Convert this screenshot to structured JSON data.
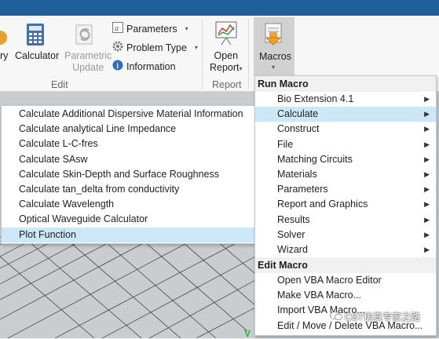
{
  "ribbon": {
    "partial_left_label": "ry",
    "calculator_label": "Calculator",
    "parametric_update_line1": "Parametric",
    "parametric_update_line2": "Update",
    "parameters_label": "Parameters",
    "problem_type_label": "Problem Type",
    "information_label": "Information",
    "edit_group_label": "Edit",
    "open_report_line1": "Open",
    "open_report_line2": "Report",
    "report_group_label": "Report",
    "macros_label": "Macros"
  },
  "macro_menu": {
    "run_header": "Run Macro",
    "run_items": [
      {
        "label": "Bio Extension 4.1"
      },
      {
        "label": "Calculate"
      },
      {
        "label": "Construct"
      },
      {
        "label": "File"
      },
      {
        "label": "Matching Circuits"
      },
      {
        "label": "Materials"
      },
      {
        "label": "Parameters"
      },
      {
        "label": "Report and Graphics"
      },
      {
        "label": "Results"
      },
      {
        "label": "Solver"
      },
      {
        "label": "Wizard"
      }
    ],
    "edit_header": "Edit Macro",
    "edit_items": [
      {
        "label": "Open VBA Macro Editor"
      },
      {
        "label": "Make VBA Macro..."
      },
      {
        "label": "Import VBA Macro..."
      },
      {
        "label": "Edit / Move / Delete VBA Macro..."
      }
    ]
  },
  "calculate_submenu": {
    "items": [
      {
        "label": "Calculate Additional Dispersive Material Information"
      },
      {
        "label": "Calculate analytical Line Impedance"
      },
      {
        "label": "Calculate L-C-fres"
      },
      {
        "label": "Calculate SAsw"
      },
      {
        "label": "Calculate Skin-Depth and Surface Roughness"
      },
      {
        "label": "Calculate tan_delta from conductivity"
      },
      {
        "label": "Calculate Wavelength"
      },
      {
        "label": "Optical Waveguide Calculator"
      },
      {
        "label": "Plot Function"
      }
    ]
  },
  "overlay": {
    "watermark_text": "CST仿真专家之路",
    "axis_label": "V"
  },
  "colors": {
    "title_bar": "#1e5f9c",
    "highlight": "#cce8f7"
  }
}
